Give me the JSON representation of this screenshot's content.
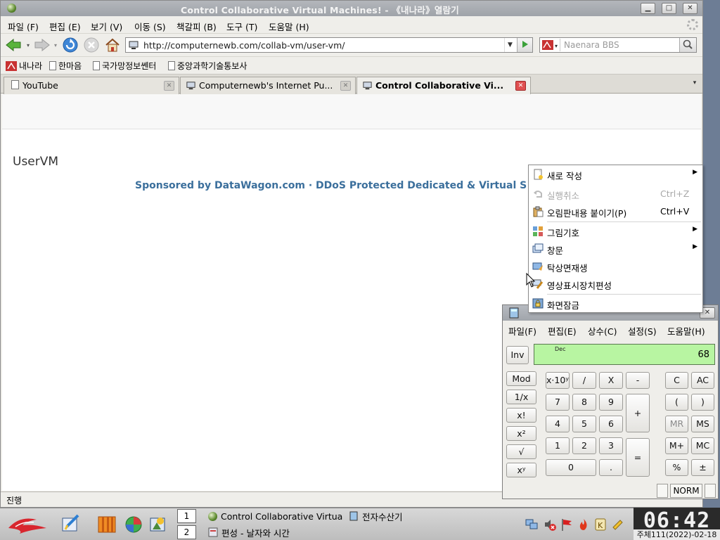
{
  "window": {
    "title": "Control Collaborative Virtual Machines! - 《내나라》열람기"
  },
  "menu": {
    "items": [
      "파일 (F)",
      "편집 (E)",
      "보기 (V)",
      "이동 (S)",
      "책갈피 (B)",
      "도구 (T)",
      "도움말 (H)"
    ]
  },
  "navbar": {
    "url": "http://computernewb.com/collab-vm/user-vm/",
    "search_placeholder": "Naenara BBS"
  },
  "bookmarks": [
    "내나라",
    "한마음",
    "국가망정보쎈터",
    "중앙과학기술통보사"
  ],
  "tabs": [
    {
      "label": "YouTube",
      "active": false
    },
    {
      "label": "Computernewb's Internet Pu...",
      "active": false
    },
    {
      "label": "Control Collaborative Vi...",
      "active": true
    }
  ],
  "page": {
    "heading": "UserVM",
    "sponsor_text": "Sponsored by DataWagon.com · DDoS Protected Dedicated & Virtual S"
  },
  "status": {
    "text": "진행"
  },
  "context_menu": {
    "items": [
      {
        "label": "새로 작성",
        "shortcut": "",
        "submenu": true,
        "disabled": false,
        "icon": "new-document-icon"
      },
      {
        "label": "실행취소",
        "shortcut": "Ctrl+Z",
        "submenu": false,
        "disabled": true,
        "icon": "undo-icon"
      },
      {
        "label": "오림판내용 붙이기(P)",
        "shortcut": "Ctrl+V",
        "submenu": false,
        "disabled": false,
        "icon": "paste-icon"
      },
      {
        "label": "그림기호",
        "shortcut": "",
        "submenu": true,
        "disabled": false,
        "icon": "icons-icon"
      },
      {
        "label": "창문",
        "shortcut": "",
        "submenu": true,
        "disabled": false,
        "icon": "window-icon"
      },
      {
        "label": "탁상면재생",
        "shortcut": "",
        "submenu": false,
        "disabled": false,
        "icon": "refresh-desktop-icon"
      },
      {
        "label": "영상표시장치편성",
        "shortcut": "",
        "submenu": false,
        "disabled": false,
        "icon": "display-settings-icon"
      },
      {
        "label": "화면잠금",
        "shortcut": "",
        "submenu": false,
        "disabled": false,
        "icon": "lock-screen-icon"
      }
    ]
  },
  "calculator": {
    "menu": [
      "파일(F)",
      "편집(E)",
      "상수(C)",
      "설정(S)",
      "도움말(H)"
    ],
    "inv_label": "Inv",
    "display_mode": "Dec",
    "display_value": "68",
    "left_keys": [
      "Mod",
      "1/x",
      "x!",
      "x²",
      "√",
      "xʸ"
    ],
    "keys": {
      "exp": "x·10ʸ",
      "div": "/",
      "mul": "X",
      "minus": "-",
      "plus": "+",
      "equals": "=",
      "d7": "7",
      "d8": "8",
      "d9": "9",
      "d4": "4",
      "d5": "5",
      "d6": "6",
      "d1": "1",
      "d2": "2",
      "d3": "3",
      "d0": "0",
      "dot": ".",
      "clear": "C",
      "all_clear": "AC",
      "lparen": "(",
      "rparen": ")",
      "mr": "MR",
      "ms": "MS",
      "mplus": "M+",
      "mc": "MC",
      "percent": "%",
      "plusminus": "±"
    },
    "norm_label": "NORM"
  },
  "taskbar": {
    "workspaces": [
      "1",
      "2"
    ],
    "tasks": [
      "Control Collaborative Virtua",
      "전자수산기",
      "편성 - 날자와 시간"
    ],
    "clock_time": "06:42",
    "clock_date": "주체111(2022)-02-18"
  },
  "colors": {
    "display_bg": "#b8f5a2",
    "sponsor_link": "#3b6f9c",
    "active_tab_close": "#e05050"
  }
}
